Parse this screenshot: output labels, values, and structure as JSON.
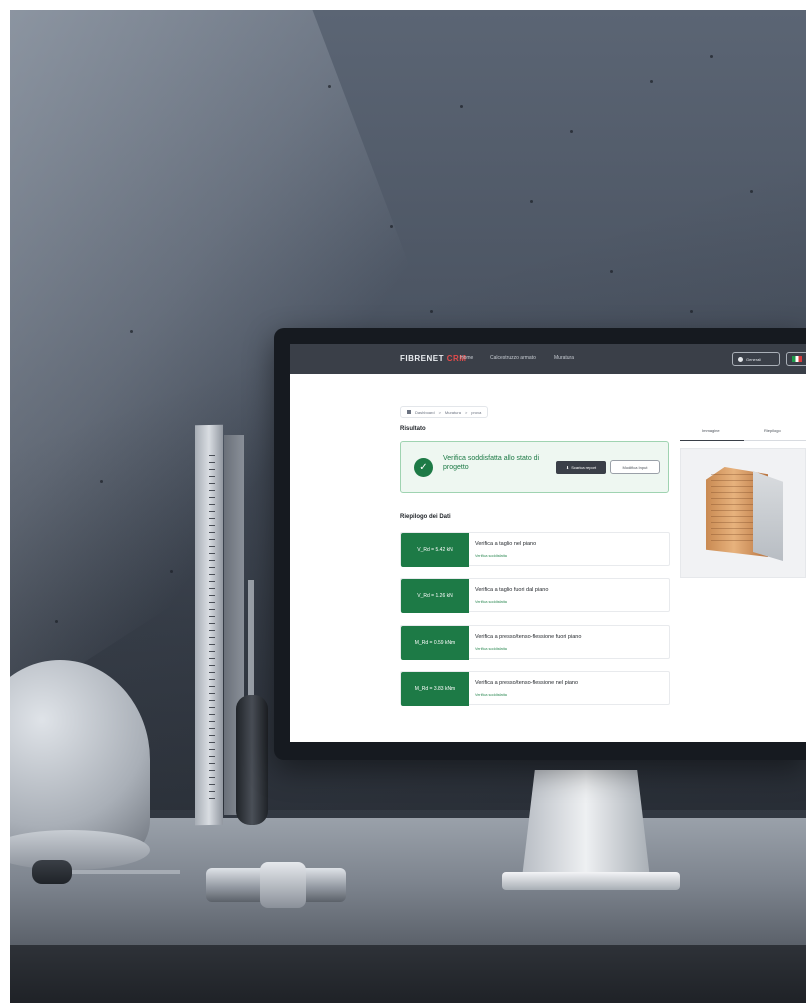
{
  "nav": {
    "brand_main": "FIBRENET",
    "brand_accent": "CRM",
    "links": [
      "Home",
      "Calcestruzzo armato",
      "Muratura"
    ],
    "user_label": "Generali"
  },
  "breadcrumb": {
    "items": [
      "Dashboard",
      "Muratura",
      "prova"
    ]
  },
  "result": {
    "section_title": "Risultato",
    "message": "Verifica soddisfatta allo stato di progetto",
    "download_label": "Scarica report",
    "edit_label": "Modifica Input"
  },
  "summary": {
    "section_title": "Riepilogo dei Dati",
    "rows": [
      {
        "badge": "V_Rd = 5.42 kN",
        "title": "Verifica a taglio nel piano",
        "status": "Verifica soddisfatta"
      },
      {
        "badge": "V_Rd = 1.26 kN",
        "title": "Verifica a taglio fuori dal piano",
        "status": "Verifica soddisfatta"
      },
      {
        "badge": "M_Rd = 0.59 kNm",
        "title": "Verifica a presso/tenso-flessione fuori piano",
        "status": "Verifica soddisfatta"
      },
      {
        "badge": "M_Rd = 3.83 kNm",
        "title": "Verifica a presso/tenso-flessione nel piano",
        "status": "Verifica soddisfatta"
      }
    ]
  },
  "panel": {
    "tabs": [
      "Immagine",
      "Riepilogo"
    ]
  },
  "colors": {
    "success": "#1d7a46",
    "nav_bg": "#3a3f48",
    "brand_accent": "#e34b4b"
  }
}
